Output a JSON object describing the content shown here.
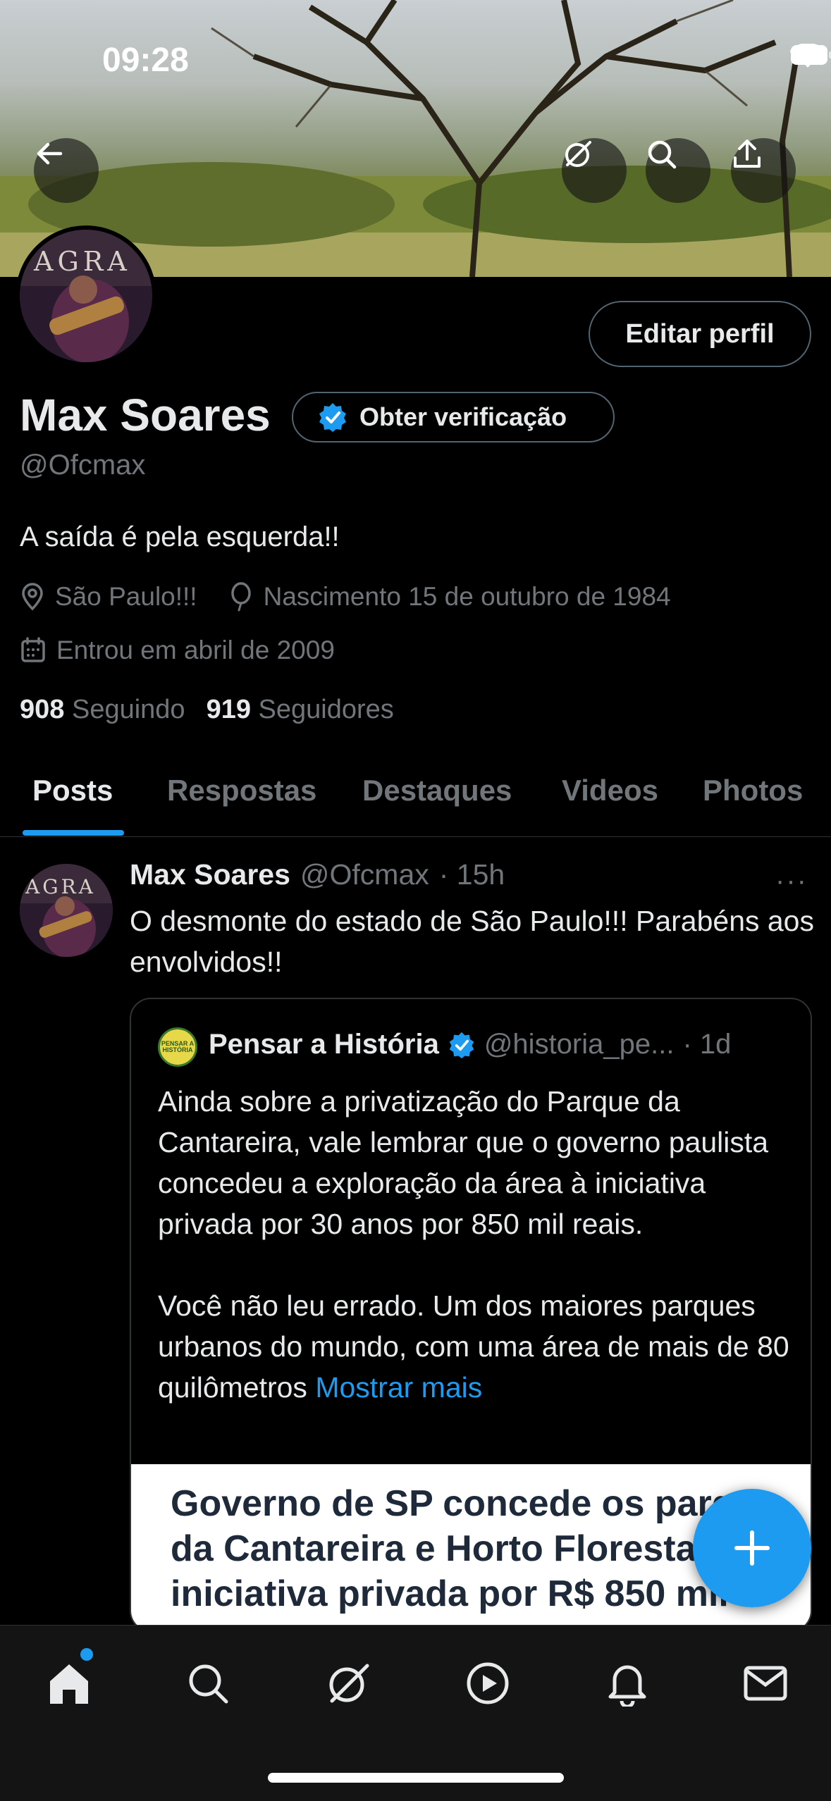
{
  "status_bar": {
    "time": "09:28"
  },
  "profile": {
    "name": "Max Soares",
    "handle": "@Ofcmax",
    "bio": "A saída é pela esquerda!!",
    "location": "São Paulo!!!",
    "birth": "Nascimento 15 de outubro de 1984",
    "joined": "Entrou em abril de 2009",
    "following_count": "908",
    "following_label": "Seguindo",
    "followers_count": "919",
    "followers_label": "Seguidores",
    "edit_button": "Editar perfil",
    "verify_button": "Obter verificação",
    "avatar_text": "AGRA"
  },
  "tabs": [
    {
      "label": "Posts",
      "active": true
    },
    {
      "label": "Respostas",
      "active": false
    },
    {
      "label": "Destaques",
      "active": false
    },
    {
      "label": "Videos",
      "active": false
    },
    {
      "label": "Photos",
      "active": false
    }
  ],
  "post": {
    "author": "Max Soares",
    "handle": "@Ofcmax",
    "time": "· 15h",
    "text": "O desmonte do estado de São Paulo!!! Parabéns aos envolvidos!!",
    "more": "···",
    "quote": {
      "author": "Pensar a História",
      "handle": "@historia_pe...",
      "time": "· 1d",
      "avatar_text": "PENSAR A HISTÓRIA",
      "text": "Ainda sobre a privatização do Parque da Cantareira, vale lembrar que o governo paulista concedeu a exploração da área à iniciativa privada por 30 anos por 850 mil reais.\n\nVocê não leu errado. Um dos maiores parques urbanos do mundo, com uma área de mais de 80 quilômetros ",
      "show_more": "Mostrar mais",
      "image_lines": [
        "Governo de SP concede os parqu",
        "da Cantareira e Horto Florestal",
        "iniciativa privada por R$ 850 mil"
      ]
    }
  },
  "colors": {
    "accent": "#1d9bf0",
    "muted": "#71767b",
    "border": "#2f3336"
  },
  "icons": {
    "back": "arrow-left-icon",
    "grok": "grok-icon",
    "search": "search-icon",
    "share": "share-icon",
    "nav": [
      "home-icon",
      "search-icon",
      "grok-icon",
      "play-icon",
      "bell-icon",
      "mail-icon"
    ]
  }
}
